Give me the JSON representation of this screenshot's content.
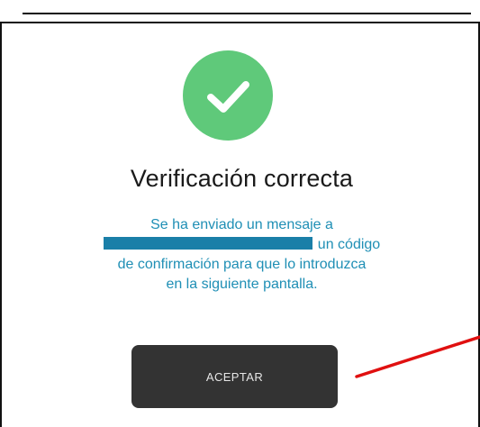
{
  "dialog": {
    "status_icon": "checkmark-circle-icon",
    "title": "Verificación correcta",
    "message": {
      "line1": "Se ha enviado un mensaje a",
      "line2_suffix": "un código",
      "line3": "de confirmación para que lo introduzca",
      "line4": "en la siguiente pantalla."
    },
    "accept_label": "ACEPTAR"
  },
  "colors": {
    "success_green": "#5fc97a",
    "message_blue": "#1f8fb5",
    "button_dark": "#333333",
    "annotation_red": "#e01010"
  }
}
